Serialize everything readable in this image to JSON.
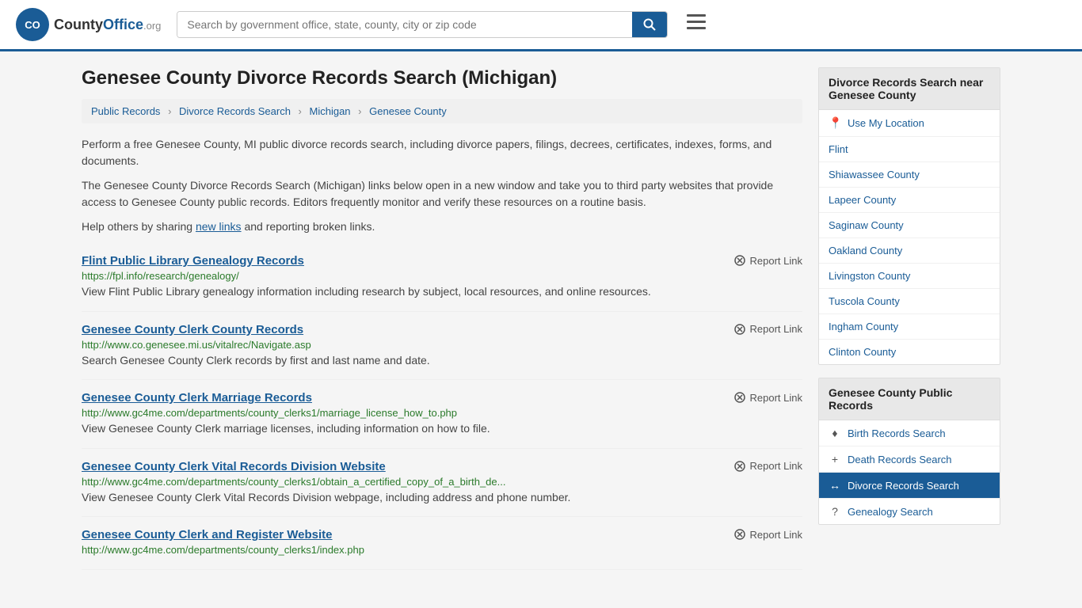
{
  "header": {
    "logo_text": "CountyOffice",
    "logo_org": ".org",
    "search_placeholder": "Search by government office, state, county, city or zip code",
    "search_icon": "🔍",
    "menu_icon": "☰"
  },
  "page": {
    "title": "Genesee County Divorce Records Search (Michigan)",
    "breadcrumbs": [
      {
        "label": "Public Records",
        "href": "#"
      },
      {
        "label": "Divorce Records Search",
        "href": "#"
      },
      {
        "label": "Michigan",
        "href": "#"
      },
      {
        "label": "Genesee County",
        "href": "#"
      }
    ],
    "description1": "Perform a free Genesee County, MI public divorce records search, including divorce papers, filings, decrees, certificates, indexes, forms, and documents.",
    "description2": "The Genesee County Divorce Records Search (Michigan) links below open in a new window and take you to third party websites that provide access to Genesee County public records. Editors frequently monitor and verify these resources on a routine basis.",
    "description3_prefix": "Help others by sharing ",
    "description3_link": "new links",
    "description3_suffix": " and reporting broken links."
  },
  "results": [
    {
      "title": "Flint Public Library Genealogy Records",
      "url": "https://fpl.info/research/genealogy/",
      "description": "View Flint Public Library genealogy information including research by subject, local resources, and online resources.",
      "report_label": "Report Link"
    },
    {
      "title": "Genesee County Clerk County Records",
      "url": "http://www.co.genesee.mi.us/vitalrec/Navigate.asp",
      "description": "Search Genesee County Clerk records by first and last name and date.",
      "report_label": "Report Link"
    },
    {
      "title": "Genesee County Clerk Marriage Records",
      "url": "http://www.gc4me.com/departments/county_clerks1/marriage_license_how_to.php",
      "description": "View Genesee County Clerk marriage licenses, including information on how to file.",
      "report_label": "Report Link"
    },
    {
      "title": "Genesee County Clerk Vital Records Division Website",
      "url": "http://www.gc4me.com/departments/county_clerks1/obtain_a_certified_copy_of_a_birth_de...",
      "description": "View Genesee County Clerk Vital Records Division webpage, including address and phone number.",
      "report_label": "Report Link"
    },
    {
      "title": "Genesee County Clerk and Register Website",
      "url": "http://www.gc4me.com/departments/county_clerks1/index.php",
      "description": "",
      "report_label": "Report Link"
    }
  ],
  "sidebar": {
    "section1_title": "Divorce Records Search near Genesee County",
    "location_item": "Use My Location",
    "nearby": [
      "Flint",
      "Shiawassee County",
      "Lapeer County",
      "Saginaw County",
      "Oakland County",
      "Livingston County",
      "Tuscola County",
      "Ingham County",
      "Clinton County"
    ],
    "section2_title": "Genesee County Public Records",
    "public_records": [
      {
        "label": "Birth Records Search",
        "icon": "♦",
        "active": false
      },
      {
        "label": "Death Records Search",
        "icon": "+",
        "active": false
      },
      {
        "label": "Divorce Records Search",
        "icon": "↔",
        "active": true
      },
      {
        "label": "Genealogy Search",
        "icon": "?",
        "active": false
      }
    ]
  }
}
